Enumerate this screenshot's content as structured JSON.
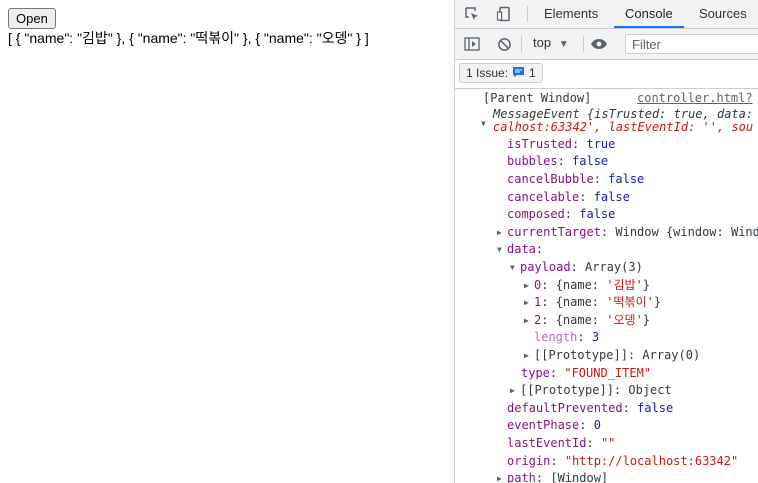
{
  "page": {
    "button_label": "Open",
    "output": "[ { \"name\": \"김밥\" }, { \"name\": \"떡볶이\" }, { \"name\": \"오뎅\" } ]"
  },
  "devtools": {
    "tabs": [
      "Elements",
      "Console",
      "Sources"
    ],
    "active_tab": "Console",
    "context": "top",
    "filter_placeholder": "Filter",
    "issues_label": "1 Issue:",
    "issues_count": "1",
    "accent_color": "#1a73e8"
  },
  "console": {
    "header": "[Parent Window]",
    "source_link": "controller.html?",
    "summary_line1": "MessageEvent {isTrusted: true, data: ",
    "summary_line2": "calhost:63342', lastEventId: '', sou",
    "props": {
      "isTrusted": {
        "k": "isTrusted",
        "v": "true"
      },
      "bubbles": {
        "k": "bubbles",
        "v": "false"
      },
      "cancelBubble": {
        "k": "cancelBubble",
        "v": "false"
      },
      "cancelable": {
        "k": "cancelable",
        "v": "false"
      },
      "composed": {
        "k": "composed",
        "v": "false"
      },
      "currentTarget": {
        "k": "currentTarget",
        "v": "Window {window: Wind"
      },
      "data": {
        "k": "data"
      },
      "payload": {
        "k": "payload",
        "v": "Array(3)"
      },
      "item0": {
        "k": "0",
        "v": "{name: '김밥'}",
        "pre": "{name: ",
        "val": "'김밥'",
        "post": "}"
      },
      "item1": {
        "k": "1",
        "v": "{name: '떡볶이'}",
        "pre": "{name: ",
        "val": "'떡볶이'",
        "post": "}"
      },
      "item2": {
        "k": "2",
        "v": "{name: '오뎅'}",
        "pre": "{name: ",
        "val": "'오뎅'",
        "post": "}"
      },
      "length": {
        "k": "length",
        "v": "3"
      },
      "proto_array": {
        "k": "[[Prototype]]",
        "v": "Array(0)"
      },
      "type": {
        "k": "type",
        "v": "\"FOUND_ITEM\""
      },
      "proto_object": {
        "k": "[[Prototype]]",
        "v": "Object"
      },
      "defaultPrevented": {
        "k": "defaultPrevented",
        "v": "false"
      },
      "eventPhase": {
        "k": "eventPhase",
        "v": "0"
      },
      "lastEventId": {
        "k": "lastEventId",
        "v": "\"\""
      },
      "origin": {
        "k": "origin",
        "v": "\"http://localhost:63342\""
      },
      "path": {
        "k": "path",
        "v": "[Window]"
      }
    }
  }
}
